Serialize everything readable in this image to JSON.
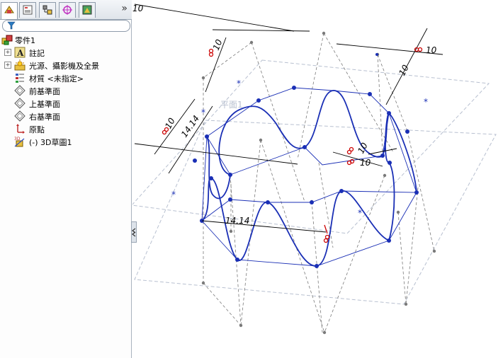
{
  "panel": {
    "more_label": "»",
    "tabs": [
      {
        "name": "feature-manager",
        "icon": "feature-tree-icon"
      },
      {
        "name": "property-manager",
        "icon": "property-manager-icon"
      },
      {
        "name": "configuration-manager",
        "icon": "configuration-icon"
      },
      {
        "name": "dimxpert-manager",
        "icon": "crosshair-icon"
      },
      {
        "name": "display-manager",
        "icon": "display-manager-icon"
      }
    ],
    "filter_icon": "filter-icon"
  },
  "tree": [
    {
      "label": "零件1",
      "icon": "part-icon",
      "expander": "",
      "level": 0
    },
    {
      "label": "註記",
      "icon": "annotation-icon",
      "expander": "+",
      "level": 1
    },
    {
      "label": "光源、攝影機及全景",
      "icon": "lights-icon",
      "expander": "+",
      "level": 1
    },
    {
      "label": "材質 <未指定>",
      "icon": "material-icon",
      "expander": "",
      "level": 1
    },
    {
      "label": "前基準面",
      "icon": "plane-icon",
      "expander": "",
      "level": 1
    },
    {
      "label": "上基準面",
      "icon": "plane-icon",
      "expander": "",
      "level": 1
    },
    {
      "label": "右基準面",
      "icon": "plane-icon",
      "expander": "",
      "level": 1
    },
    {
      "label": "原點",
      "icon": "origin-icon",
      "expander": "",
      "level": 1
    },
    {
      "label": "(-) 3D草圖1",
      "icon": "3d-sketch-icon",
      "expander": "",
      "level": 1
    }
  ],
  "viewport": {
    "plane_label": "平面1",
    "dimensions": [
      "10",
      "10",
      "10",
      "10",
      "10",
      "10",
      "14.14",
      "14.14",
      "10"
    ],
    "colors": {
      "curve": "#1a2fb5",
      "construction": "#7a7a7a",
      "plane": "#b8c0d0",
      "dimension": "#000000",
      "relation": "#cc0000"
    }
  }
}
